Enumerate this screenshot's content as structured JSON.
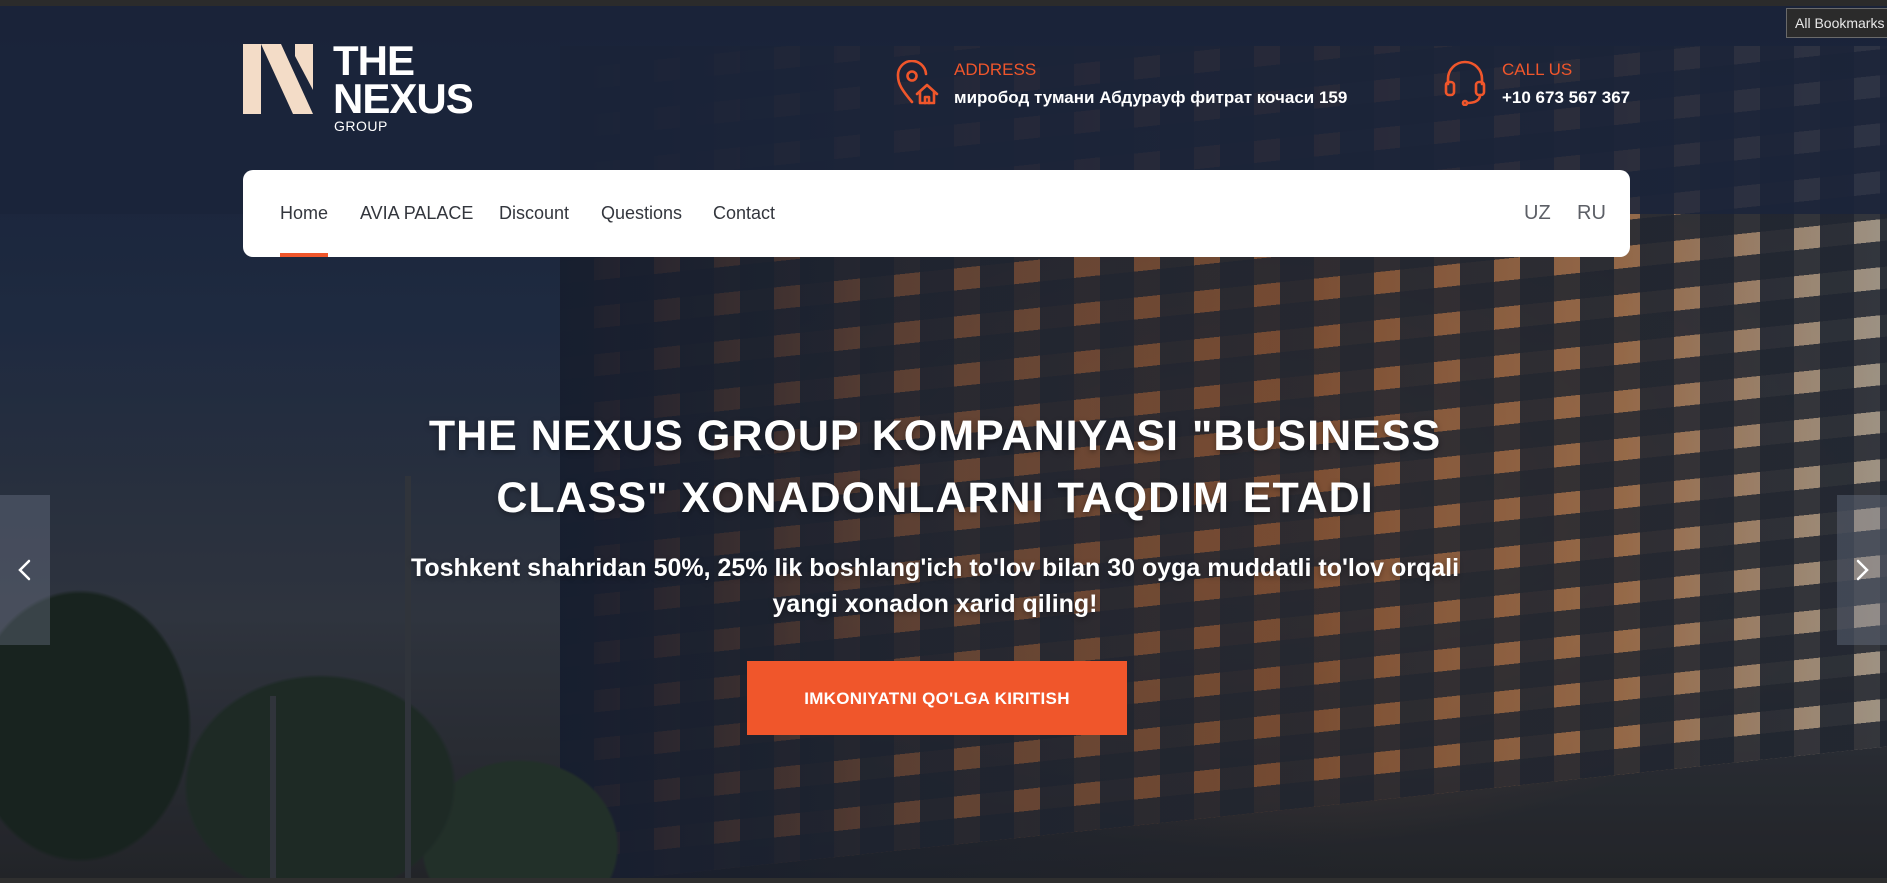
{
  "browser": {
    "bookmarks_label": "All Bookmarks"
  },
  "brand": {
    "line1": "THE",
    "line2": "NEXUS",
    "line3": "GROUP",
    "logo_color": "#f3dcc7"
  },
  "contacts": {
    "address": {
      "label": "ADDRESS",
      "value": "миробод тумани Абдурауф фитрат кочаси 159",
      "icon": "location-home-icon"
    },
    "phone": {
      "label": "CALL US",
      "value": "+10 673 567 367",
      "icon": "headset-icon"
    }
  },
  "nav": {
    "items": [
      {
        "label": "Home",
        "active": true
      },
      {
        "label": "AVIA PALACE",
        "active": false
      },
      {
        "label": "Discount",
        "active": false
      },
      {
        "label": "Questions",
        "active": false
      },
      {
        "label": "Contact",
        "active": false
      }
    ],
    "languages": [
      "UZ",
      "RU"
    ]
  },
  "hero": {
    "title_line1": "THE NEXUS GROUP KOMPANIYASI \"BUSINESS",
    "title_line2": "CLASS\" XONADONLARNI TAQDIM ETADI",
    "subtitle_line1": "Toshkent shahridan 50%, 25% lik boshlang'ich to'lov bilan 30 oyga muddatli to'lov orqali",
    "subtitle_line2": "yangi xonadon xarid qiling!",
    "cta_label": "IMKONIYATNI QO'LGA KIRITISH"
  },
  "slider": {
    "prev_icon": "chevron-left-icon",
    "next_icon": "chevron-right-icon"
  },
  "colors": {
    "accent": "#f0562b",
    "header_bg": "#1b243a",
    "nav_bg": "#ffffff"
  }
}
